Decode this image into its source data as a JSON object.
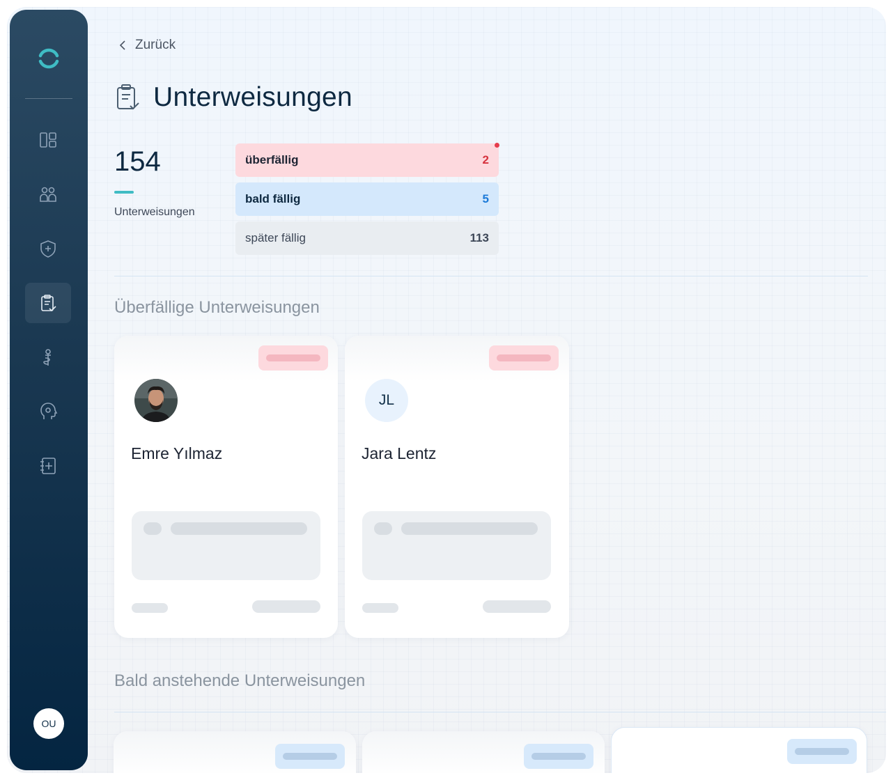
{
  "nav": {
    "back_label": "Zurück",
    "user_initials": "OU",
    "items": [
      "dashboard-icon",
      "people-icon",
      "shield-plus-icon",
      "clipboard-check-icon",
      "medical-icon",
      "head-icon",
      "notebook-plus-icon"
    ],
    "active_item": "clipboard-check-icon"
  },
  "page": {
    "title": "Unterweisungen",
    "title_icon": "clipboard-check-icon"
  },
  "stats": {
    "total": "154",
    "total_label": "Unterweisungen",
    "overdue_label": "überfällig",
    "overdue_count": "2",
    "soon_label": "bald fällig",
    "soon_count": "5",
    "later_label": "später fällig",
    "later_count": "113"
  },
  "sections": {
    "overdue_title": "Überfällige Unterweisungen",
    "upcoming_title": "Bald anstehende Unterweisungen"
  },
  "overdue_cards": [
    {
      "name": "Emre Yılmaz",
      "avatar": "photo"
    },
    {
      "name": "Jara Lentz",
      "initials": "JL"
    }
  ],
  "colors": {
    "accent": "#3fbcc4",
    "overdue": "#d6333f",
    "soon": "#1c7ad8",
    "sidebar_top": "#2b4a63",
    "sidebar_bottom": "#042541"
  }
}
